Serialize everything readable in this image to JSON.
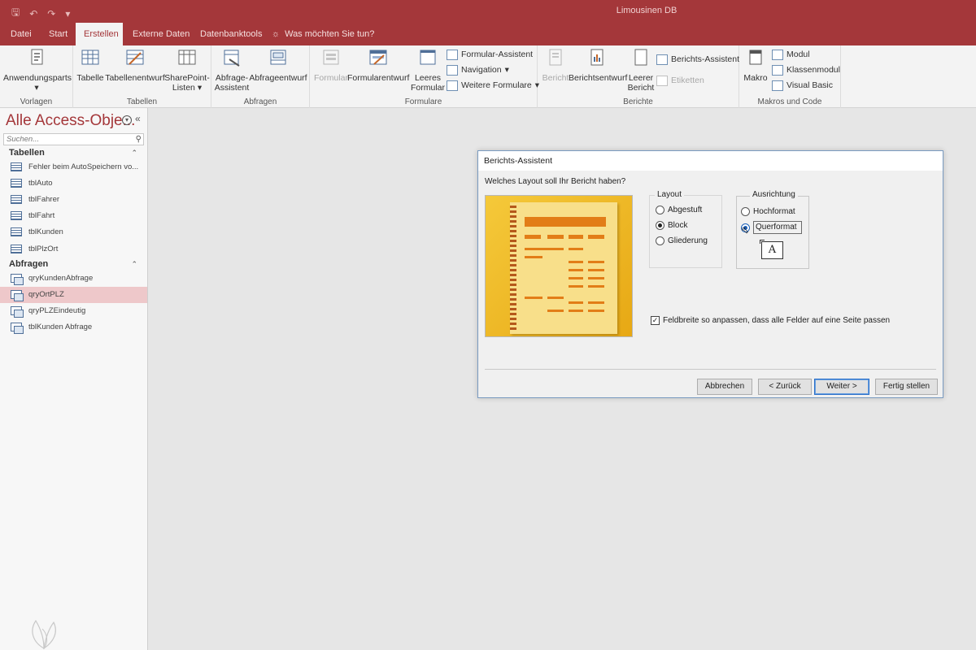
{
  "titlebar": {
    "app_title": "Limousinen DB",
    "qat_icons": [
      "save-icon",
      "undo-icon",
      "redo-icon",
      "customize-icon"
    ]
  },
  "tabs": [
    {
      "label": "Datei"
    },
    {
      "label": "Start"
    },
    {
      "label": "Erstellen",
      "active": true
    },
    {
      "label": "Externe Daten"
    },
    {
      "label": "Datenbanktools"
    }
  ],
  "tell_me": "Was möchten Sie tun?",
  "ribbon": {
    "vorlagen": {
      "label": "Vorlagen",
      "anwendungsparts": "Anwendungsparts"
    },
    "tabellen": {
      "label": "Tabellen",
      "tabelle": "Tabelle",
      "tabellenentwurf": "Tabellenentwurf",
      "sharepoint_1": "SharePoint-",
      "sharepoint_2": "Listen"
    },
    "abfragen": {
      "label": "Abfragen",
      "assistent_1": "Abfrage-",
      "assistent_2": "Assistent",
      "entwurf": "Abfrageentwurf"
    },
    "formulare": {
      "label": "Formulare",
      "formular": "Formular",
      "formularentwurf": "Formularentwurf",
      "leeres_1": "Leeres",
      "leeres_2": "Formular",
      "assistent": "Formular-Assistent",
      "navigation": "Navigation",
      "weitere": "Weitere Formulare"
    },
    "berichte": {
      "label": "Berichte",
      "bericht": "Bericht",
      "berichtsentwurf": "Berichtsentwurf",
      "leerer_1": "Leerer",
      "leerer_2": "Bericht",
      "assistent": "Berichts-Assistent",
      "etiketten": "Etiketten"
    },
    "makros": {
      "label": "Makros und Code",
      "makro": "Makro",
      "modul": "Modul",
      "klassenmodul": "Klassenmodul",
      "vba": "Visual Basic"
    }
  },
  "nav": {
    "title": "Alle Access-Obje...",
    "search_placeholder": "Suchen...",
    "sections": [
      {
        "label": "Tabellen",
        "items": [
          "Fehler beim AutoSpeichern vo...",
          "tblAuto",
          "tblFahrer",
          "tblFahrt",
          "tblKunden",
          "tblPlzOrt"
        ]
      },
      {
        "label": "Abfragen",
        "items": [
          "qryKundenAbfrage",
          "qryOrtPLZ",
          "qryPLZEindeutig",
          "tblKunden Abfrage"
        ]
      }
    ],
    "selected": "qryOrtPLZ"
  },
  "dialog": {
    "title": "Berichts-Assistent",
    "question": "Welches Layout soll Ihr Bericht haben?",
    "layout_label": "Layout",
    "layout_options": [
      {
        "label": "Abgestuft",
        "selected": false
      },
      {
        "label": "Block",
        "selected": true
      },
      {
        "label": "Gliederung",
        "selected": false
      }
    ],
    "orientation_label": "Ausrichtung",
    "orientation_options": [
      {
        "label": "Hochformat",
        "selected": false
      },
      {
        "label": "Querformat",
        "selected": true
      }
    ],
    "orientation_icon_letter": "A",
    "fit_checkbox": {
      "label": "Feldbreite so anpassen, dass alle Felder auf eine Seite passen",
      "checked": true,
      "mark": "✓"
    },
    "buttons": {
      "cancel": "Abbrechen",
      "back": "< Zurück",
      "next": "Weiter >",
      "finish": "Fertig stellen"
    }
  },
  "colors": {
    "accent": "#a4373a",
    "selected_row": "#eec8ca",
    "dialog_bg": "#f0f0f0"
  }
}
